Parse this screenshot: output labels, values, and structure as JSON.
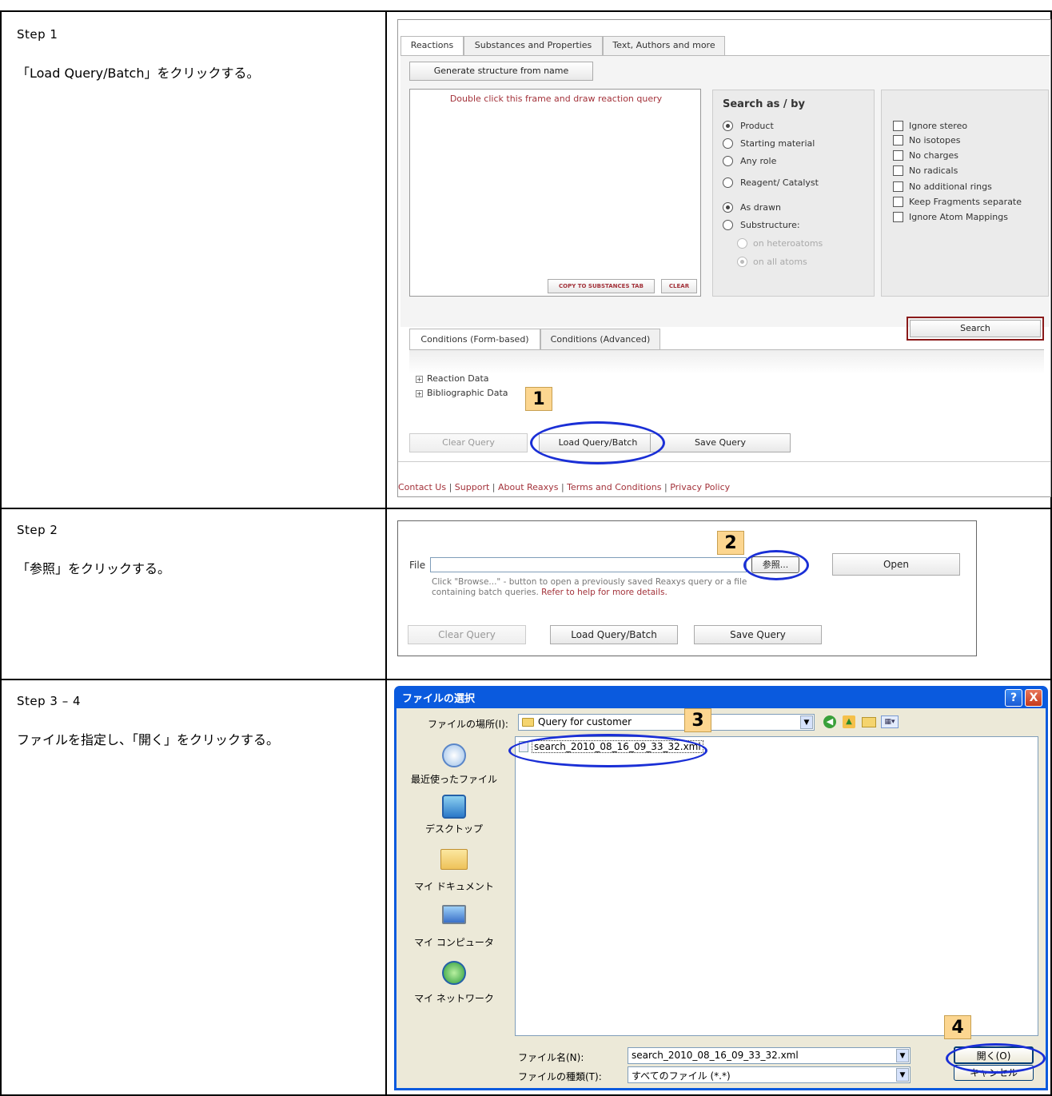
{
  "steps": [
    {
      "title": "Step 1",
      "desc": "「Load Query/Batch」をクリックする。"
    },
    {
      "title": "Step 2",
      "desc": "「参照」をクリックする。"
    },
    {
      "title": "Step 3 – 4",
      "desc": "ファイルを指定し、「開く」をクリックする。"
    }
  ],
  "reaxys": {
    "tabs": [
      "Reactions",
      "Substances and Properties",
      "Text, Authors and more"
    ],
    "generate_btn": "Generate structure from name",
    "draw_hint": "Double click this frame and draw reaction query",
    "copy_btn": "COPY TO SUBSTANCES TAB",
    "clear_btn": "CLEAR",
    "search_as_title": "Search as / by",
    "roles": [
      "Product",
      "Starting material",
      "Any role",
      "Reagent/ Catalyst"
    ],
    "modes": [
      "As drawn",
      "Substructure:"
    ],
    "sub_modes": [
      "on heteroatoms",
      "on all atoms"
    ],
    "options": [
      "Ignore stereo",
      "No isotopes",
      "No charges",
      "No radicals",
      "No additional rings",
      "Keep Fragments separate",
      "Ignore Atom Mappings"
    ],
    "search_btn": "Search",
    "cond_tabs": [
      "Conditions (Form-based)",
      "Conditions (Advanced)"
    ],
    "tree": [
      "Reaction Data",
      "Bibliographic Data"
    ],
    "clear_query": "Clear Query",
    "load_query": "Load Query/Batch",
    "save_query": "Save Query",
    "footer": [
      "Contact Us",
      "Support",
      "About Reaxys",
      "Terms and Conditions",
      "Privacy Policy"
    ],
    "footer_sep": "|"
  },
  "step2": {
    "file_label": "File",
    "browse_btn": "参照...",
    "open_btn": "Open",
    "hint_line1": "Click \"Browse...\" - button to open a previously saved Reaxys query or a file",
    "hint_line2_plain": "containing batch queries. ",
    "hint_line2_link": "Refer to help for more details.",
    "clear_query": "Clear Query",
    "load_query": "Load Query/Batch",
    "save_query": "Save Query"
  },
  "dialog": {
    "title": "ファイルの選択",
    "help_glyph": "?",
    "close_glyph": "X",
    "location_label": "ファイルの場所(I):",
    "location_value": "Query for customer",
    "file_item": "search_2010_08_16_09_33_32.xml",
    "places": [
      "最近使ったファイル",
      "デスクトップ",
      "マイ ドキュメント",
      "マイ コンピュータ",
      "マイ ネットワーク"
    ],
    "filename_label": "ファイル名(N):",
    "filename_value": "search_2010_08_16_09_33_32.xml",
    "filetype_label": "ファイルの種類(T):",
    "filetype_value": "すべてのファイル (*.*)",
    "open_btn": "開く(O)",
    "cancel_btn": "キャンセル"
  },
  "badges": [
    "1",
    "2",
    "3",
    "4"
  ],
  "colors": {
    "callout_oval": "#1a2fd6",
    "badge_fill": "#fcd690",
    "xp_title": "#0a5ade",
    "link": "#a3323a",
    "search_border": "#8a1a1a"
  }
}
